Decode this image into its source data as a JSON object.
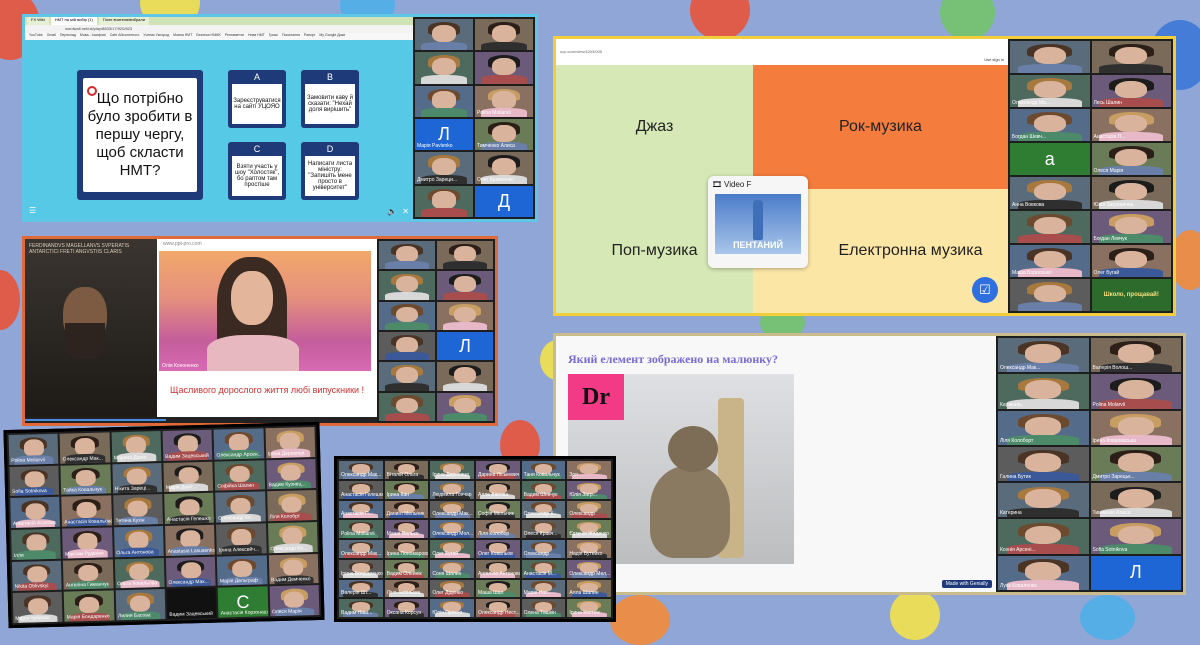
{
  "colors": {
    "bg": "#8fa6d6",
    "quiz_bg": "#55c9e6",
    "card_navy": "#1f3a78",
    "music_green": "#d6e8b5",
    "music_orange": "#f47c3c",
    "music_yellow": "#fce6a6",
    "frame_yellow": "#f2cf3a",
    "frame_orange": "#e0693a"
  },
  "browser": {
    "url": "wordwall.net/uk/play/8833/17/920/823",
    "tabs": [
      "",
      "FX Wiki",
      "",
      "",
      "НМТ на мій вибір (1)",
      "Поле вчителя/вибрали"
    ],
    "bookmarks": [
      "YouTube",
      "Gmail",
      "Переклад",
      "Мова - Iосифові",
      "Cafe Абсолютного",
      "Ученик Ужгород",
      "Мовна НМТ",
      "Безпека HNMK",
      "Регламенти",
      "Нова НМТ",
      "Гроші",
      "Посилання",
      "Рапорт",
      "My Google Доки"
    ]
  },
  "quiz": {
    "question": "Що потрібно було зробити в першу чергу, щоб скласти НМТ?",
    "answers": [
      {
        "letter": "A",
        "text": "Зареєструватися на сайті УЦОЯО"
      },
      {
        "letter": "B",
        "text": "Замовити каву й сказати: \"Нехай доля вирішить\""
      },
      {
        "letter": "C",
        "text": "Взяти участь у шоу \"Холостяк\", бо раптом там простіше"
      },
      {
        "letter": "D",
        "text": "Написати листа міністру: \"Запишіть мене просто в університет\""
      }
    ]
  },
  "panel1_participants": [
    {
      "name": ""
    },
    {
      "name": ""
    },
    {
      "name": ""
    },
    {
      "name": ""
    },
    {
      "name": "",
      "tag": ""
    },
    {
      "name": "Polina Moliarvii",
      "tag": ""
    },
    {
      "name": "Марія Pavlenko",
      "avatar": "Л"
    },
    {
      "name": "Тимченко Алиса"
    },
    {
      "name": "Дмитро Зареци...",
      "tag": ""
    },
    {
      "name": "Олег Кравченко"
    },
    {
      "name": ""
    },
    {
      "name": "",
      "avatar": "Д"
    }
  ],
  "music": {
    "url": "ucp.com/view/4203/005",
    "sign_in": "Use sign in",
    "cells": [
      "Джаз",
      "Рок-музика",
      "Поп-музика",
      "Електронна музика"
    ],
    "video_label": "Video F",
    "video_caption": "ПЕНТАНИЙ"
  },
  "panel2_participants": [
    {
      "name": "",
      "tag": ""
    },
    {
      "name": ""
    },
    {
      "name": "Олександр Ма...",
      "tag": ""
    },
    {
      "name": "Лесь Шалин"
    },
    {
      "name": "Богдан Шевч..."
    },
    {
      "name": "Анастасія П..."
    },
    {
      "name": "",
      "avatar": "a"
    },
    {
      "name": "Олеся Марія"
    },
    {
      "name": "Анна Вовкова"
    },
    {
      "name": "Юлія Загранична"
    },
    {
      "name": ""
    },
    {
      "name": "Богдан Левчук"
    },
    {
      "name": "Маша Борисенко"
    },
    {
      "name": "Олег Бугай"
    },
    {
      "name": ""
    },
    {
      "name": "Школо, прощавай!",
      "special": true
    }
  ],
  "grad": {
    "portrait_caption": "FERDINANDVS MAGELLANVS SVPERATIS ANTARCTICI FRETI ANGVSTIIS CLARIS",
    "site": "www.ppt-pro.com",
    "speaker_name": "Олія Кононенко",
    "message": "Щасливого дорослого життя любі випускники !"
  },
  "panel3_participants": [
    {
      "name": ""
    },
    {
      "name": ""
    },
    {
      "name": ""
    },
    {
      "name": ""
    },
    {
      "name": ""
    },
    {
      "name": ""
    },
    {
      "name": ""
    },
    {
      "name": "",
      "avatar": "Л"
    },
    {
      "name": ""
    },
    {
      "name": ""
    },
    {
      "name": ""
    },
    {
      "name": ""
    }
  ],
  "chem": {
    "question": "Який елемент зображено на малюнку?",
    "symbol": "Dr",
    "footer": "Made with Genially"
  },
  "panel4_participants": [
    {
      "name": "Олександр Мак..."
    },
    {
      "name": "Валерія Волош..."
    },
    {
      "name": "Каракаль"
    },
    {
      "name": "Polina Molarvii"
    },
    {
      "name": "Ліля Колоборт"
    },
    {
      "name": "Ірина Ковалевська"
    },
    {
      "name": "Галина Бутик"
    },
    {
      "name": "Дмитро Зарецьк..."
    },
    {
      "name": "Катерина"
    },
    {
      "name": "Тимченко Алиса"
    },
    {
      "name": "Ксенія Арсені..."
    },
    {
      "name": "Sofia Sotnikova"
    },
    {
      "name": "Лука Коваленко"
    },
    {
      "name": "",
      "avatar": "Л"
    }
  ],
  "gallery1": [
    {
      "name": "Polina Moliarvii"
    },
    {
      "name": "Олександр Мак..."
    },
    {
      "name": "Марина Діана"
    },
    {
      "name": "Вадим Зацевський"
    },
    {
      "name": "Олександр Арсен..."
    },
    {
      "name": "Ірина Деревиця"
    },
    {
      "name": "Sofia Sotnikova"
    },
    {
      "name": "Тайка Ковальчук"
    },
    {
      "name": "Нікита Зареці..."
    },
    {
      "name": "Марія Дмит..."
    },
    {
      "name": "Софійка Шалин"
    },
    {
      "name": "Вадим Кузнец..."
    },
    {
      "name": "Анастасія Агапова"
    },
    {
      "name": "Анастасія Ковальова"
    },
    {
      "name": "Тетяна Кузін"
    },
    {
      "name": "Анастасія Гелешко"
    },
    {
      "name": "Олександр Ко..."
    },
    {
      "name": "Ліля Колобрт"
    },
    {
      "name": "Ілля"
    },
    {
      "name": "Максим Руденко"
    },
    {
      "name": "Ольга Антонова"
    },
    {
      "name": "Anastasia Lasusenko"
    },
    {
      "name": "Ірина Алексейч..."
    },
    {
      "name": "Олександр Ко..."
    },
    {
      "name": "Nikita Oblivskyi"
    },
    {
      "name": "Ангеліна Гиманчук"
    },
    {
      "name": "Ольга Ковальова"
    },
    {
      "name": "Олександр Мак..."
    },
    {
      "name": "Марія Дельграф"
    },
    {
      "name": "Вадим Демченко"
    },
    {
      "name": "Марія Чубенко"
    },
    {
      "name": "Марія Бондаренко"
    },
    {
      "name": "Лилия Басова"
    },
    {
      "name": "Вадим Зацевський"
    },
    {
      "name": "Анастасія Корзонаш"
    },
    {
      "name": "Олеся Марія"
    }
  ],
  "gallery1_avatars": {
    "33": "",
    "34": "C"
  },
  "gallery2": [
    {
      "name": "Олександр Мак..."
    },
    {
      "name": "Віталій Ольга"
    },
    {
      "name": "Ірина Деревиця"
    },
    {
      "name": "Дарина Ліськевич"
    },
    {
      "name": "Таня Ковальчук"
    },
    {
      "name": "Зоя"
    },
    {
      "name": "Анастасія Гелешко"
    },
    {
      "name": "Ірина Кан"
    },
    {
      "name": "Людмила Гончар"
    },
    {
      "name": "Алла Басова"
    },
    {
      "name": "Вадим Шевчук"
    },
    {
      "name": "Юлія Загр..."
    },
    {
      "name": "Анастасія П..."
    },
    {
      "name": "Даниїл Мельник"
    },
    {
      "name": "Олександр Мак..."
    },
    {
      "name": "Софія Мельник"
    },
    {
      "name": "Олександр К..."
    },
    {
      "name": "Олександр"
    },
    {
      "name": "Polina Moliarvii"
    },
    {
      "name": "Маша Валько"
    },
    {
      "name": "Олександр Мол..."
    },
    {
      "name": "Ліля Колобор"
    },
    {
      "name": "Олеся Кравч..."
    },
    {
      "name": "Євгенія Жиденко"
    },
    {
      "name": "Олександр Мак..."
    },
    {
      "name": "Ірина Пономарова"
    },
    {
      "name": "Олег Бугай"
    },
    {
      "name": "Олег Ковальов"
    },
    {
      "name": "Олександр"
    },
    {
      "name": "Надія Бутейко"
    },
    {
      "name": "Ірина Бондаренко"
    },
    {
      "name": "Вадим Олейнік"
    },
    {
      "name": "Соня Шалин"
    },
    {
      "name": "Ангеліна Антонова"
    },
    {
      "name": "Анастасія М..."
    },
    {
      "name": "Олександр Мел..."
    },
    {
      "name": "Валерія Шт..."
    },
    {
      "name": "Ліна Аксіньєва"
    },
    {
      "name": "Олег Діденко"
    },
    {
      "name": "Маша Шал"
    },
    {
      "name": "Марія Нат..."
    },
    {
      "name": "Алла Шалин"
    },
    {
      "name": "Вадим Наш..."
    },
    {
      "name": "Оксана Корсун"
    },
    {
      "name": "Юлія Прокоп"
    },
    {
      "name": "Олександр Нест..."
    },
    {
      "name": "Олена Ташкін"
    },
    {
      "name": "Ірина Костюк"
    }
  ]
}
